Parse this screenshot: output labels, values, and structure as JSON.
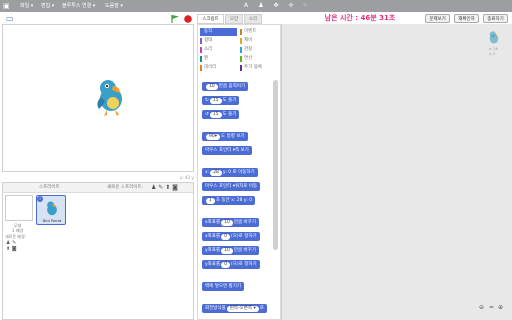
{
  "menubar": {
    "logo": "▣",
    "items": [
      {
        "label": "파일 ▾"
      },
      {
        "label": "편집 ▾"
      },
      {
        "label": "블루투스 연결 ▾"
      },
      {
        "label": "도움말 ▾"
      }
    ],
    "tools": [
      "A",
      "♟",
      "✥",
      "✢",
      "⁘"
    ]
  },
  "stage": {
    "view_label": "▭",
    "coords": "x: 43  y: -21"
  },
  "tabs": [
    {
      "label": "스크립트",
      "active": true
    },
    {
      "label": "모양",
      "active": false
    },
    {
      "label": "소리",
      "active": false
    }
  ],
  "categories": [
    {
      "label": "동작",
      "color": "#4a6cd4",
      "active": true
    },
    {
      "label": "이벤트",
      "color": "#c88330"
    },
    {
      "label": "형태",
      "color": "#8a55d7"
    },
    {
      "label": "제어",
      "color": "#e1a91a"
    },
    {
      "label": "소리",
      "color": "#bb42c3"
    },
    {
      "label": "관찰",
      "color": "#2ca5e2"
    },
    {
      "label": "펜",
      "color": "#0e9a6c"
    },
    {
      "label": "연산",
      "color": "#5cb712"
    },
    {
      "label": "데이터",
      "color": "#ee7d16"
    },
    {
      "label": "추가 블록",
      "color": "#632d99"
    }
  ],
  "blocks": [
    {
      "pre": "",
      "val": "10",
      "post": "만큼 움직이기"
    },
    {
      "pre": "↻",
      "val": "15",
      "post": "도 돌기"
    },
    {
      "pre": "↺",
      "val": "15",
      "post": "도 돌기"
    },
    {
      "pre": "",
      "val": "90▾",
      "post": "도 방향 보기"
    },
    {
      "pre": "마우스 포인터 ▾",
      "val": "",
      "post": "쪽 보기"
    },
    {
      "pre": "x:",
      "val": "28",
      "post": "y: 0 로 이동하기"
    },
    {
      "pre": "마우스 포인터 ▾",
      "val": "",
      "post": "위치로 이동"
    },
    {
      "pre": "",
      "val": "1",
      "post": "초 동안 x: 28 y: 0"
    },
    {
      "pre": "x좌표를",
      "val": "10",
      "post": "만큼 바꾸기"
    },
    {
      "pre": "x좌표를",
      "val": "0",
      "post": "(으)로 정하기"
    },
    {
      "pre": "y좌표를",
      "val": "10",
      "post": "만큼 바꾸기"
    },
    {
      "pre": "y좌표를",
      "val": "0",
      "post": "(으)로 정하기"
    },
    {
      "pre": "벽에 닿으면 튕기기",
      "val": "",
      "post": ""
    },
    {
      "pre": "회전방식을",
      "val": "왼쪽-오른쪽 ▾",
      "post": "로"
    }
  ],
  "timer": "남은 시간 : 46분 31초",
  "buttons": [
    "문제보기",
    "재확인하",
    "종료하기"
  ],
  "sprite_panel": {
    "title": "스프라이트",
    "new_sprite": "새로운 스프라이트:",
    "stage_label": "무대",
    "stage_sub": "1 배경",
    "new_bg": "새로운 배경:",
    "sprite_name": "Bird Parrot",
    "sprite_badge": "i"
  },
  "script_sprite_info": {
    "x": "x: 28",
    "y": "y: 0"
  },
  "zoom": [
    "⊖",
    "=",
    "⊕"
  ],
  "colors": {
    "accent": "#4a6cd4",
    "timer": "#e0307a",
    "parrot": "#3aa0c8"
  }
}
